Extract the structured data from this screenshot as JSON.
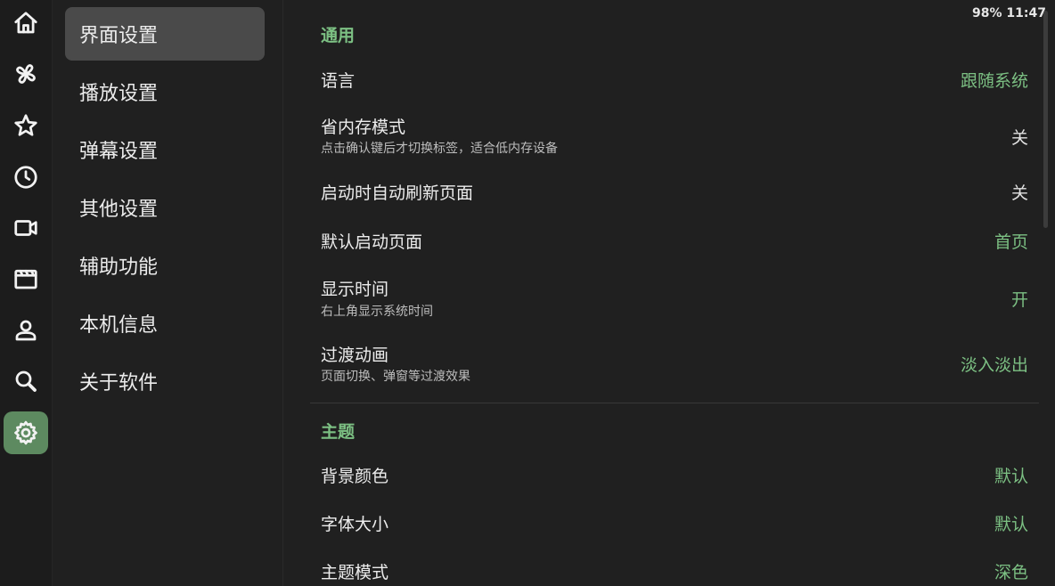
{
  "status_bar": {
    "battery": "98%",
    "time": "11:47"
  },
  "rail": {
    "items": [
      {
        "name": "home-icon"
      },
      {
        "name": "pinwheel-icon"
      },
      {
        "name": "star-icon"
      },
      {
        "name": "clock-icon"
      },
      {
        "name": "video-icon"
      },
      {
        "name": "clapperboard-icon"
      },
      {
        "name": "person-icon"
      },
      {
        "name": "search-icon"
      },
      {
        "name": "gear-icon",
        "active": true
      }
    ],
    "accent_color": "#5d8a60"
  },
  "menu": {
    "items": [
      {
        "label": "界面设置",
        "active": true
      },
      {
        "label": "播放设置"
      },
      {
        "label": "弹幕设置"
      },
      {
        "label": "其他设置"
      },
      {
        "label": "辅助功能"
      },
      {
        "label": "本机信息"
      },
      {
        "label": "关于软件"
      }
    ]
  },
  "content": {
    "sections": [
      {
        "title": "通用",
        "rows": [
          {
            "label": "语言",
            "value": "跟随系统"
          },
          {
            "label": "省内存模式",
            "sub": "点击确认键后才切换标签，适合低内存设备",
            "value": "关"
          },
          {
            "label": "启动时自动刷新页面",
            "value": "关"
          },
          {
            "label": "默认启动页面",
            "value": "首页"
          },
          {
            "label": "显示时间",
            "sub": "右上角显示系统时间",
            "value": "开"
          },
          {
            "label": "过渡动画",
            "sub": "页面切换、弹窗等过渡效果",
            "value": "淡入淡出"
          }
        ]
      },
      {
        "title": "主题",
        "rows": [
          {
            "label": "背景颜色",
            "value": "默认"
          },
          {
            "label": "字体大小",
            "value": "默认"
          },
          {
            "label": "主题模式",
            "value": "深色"
          }
        ]
      }
    ],
    "accent_color": "#7cc083"
  }
}
